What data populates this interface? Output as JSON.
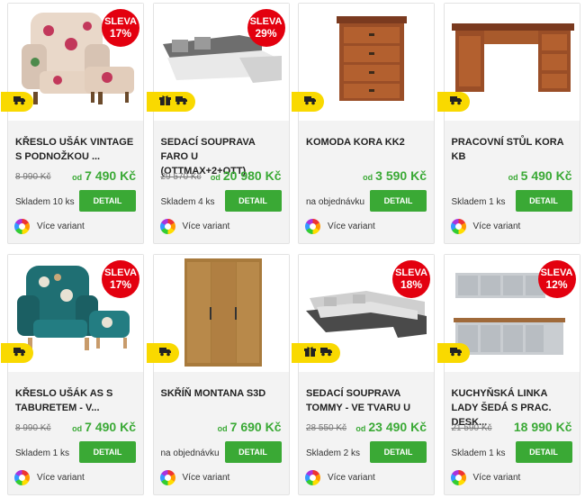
{
  "products": [
    {
      "title": "KŘESLO UŠÁK VINTAGE S PODNOŽKOU ...",
      "old_price": "8 990 Kč",
      "price_prefix": "od",
      "price": "7 490 Kč",
      "stock": "Skladem 10 ks",
      "button": "DETAIL",
      "variants": "Více variant",
      "sale_label": "SLEVA",
      "sale_pct": "17%",
      "tags": [
        "truck-icon"
      ]
    },
    {
      "title": "SEDACÍ SOUPRAVA FARO U (OTTMAX+2+OTT)",
      "old_price": "29 570 Kč",
      "price_prefix": "od",
      "price": "20 980 Kč",
      "stock": "Skladem 4 ks",
      "button": "DETAIL",
      "variants": "Více variant",
      "sale_label": "SLEVA",
      "sale_pct": "29%",
      "tags": [
        "gift-icon",
        "truck-icon"
      ]
    },
    {
      "title": "KOMODA KORA KK2",
      "old_price": "",
      "price_prefix": "od",
      "price": "3 590 Kč",
      "stock": "na objednávku",
      "button": "DETAIL",
      "variants": "Více variant",
      "sale_label": "",
      "sale_pct": "",
      "tags": [
        "truck-icon"
      ]
    },
    {
      "title": "PRACOVNÍ STŮL KORA KB",
      "old_price": "",
      "price_prefix": "od",
      "price": "5 490 Kč",
      "stock": "Skladem 1 ks",
      "button": "DETAIL",
      "variants": "Více variant",
      "sale_label": "",
      "sale_pct": "",
      "tags": [
        "truck-icon"
      ]
    },
    {
      "title": "KŘESLO UŠÁK AS S TABURETEM - V...",
      "old_price": "8 990 Kč",
      "price_prefix": "od",
      "price": "7 490 Kč",
      "stock": "Skladem 1 ks",
      "button": "DETAIL",
      "variants": "Více variant",
      "sale_label": "SLEVA",
      "sale_pct": "17%",
      "tags": [
        "truck-icon"
      ]
    },
    {
      "title": "SKŘÍŇ MONTANA S3D",
      "old_price": "",
      "price_prefix": "od",
      "price": "7 690 Kč",
      "stock": "na objednávku",
      "button": "DETAIL",
      "variants": "Více variant",
      "sale_label": "",
      "sale_pct": "",
      "tags": [
        "truck-icon"
      ]
    },
    {
      "title": "SEDACÍ SOUPRAVA TOMMY - VE TVARU U",
      "old_price": "28 550 Kč",
      "price_prefix": "od",
      "price": "23 490 Kč",
      "stock": "Skladem 2 ks",
      "button": "DETAIL",
      "variants": "Více variant",
      "sale_label": "SLEVA",
      "sale_pct": "18%",
      "tags": [
        "gift-icon",
        "truck-icon"
      ]
    },
    {
      "title": "KUCHYŇSKÁ LINKA LADY ŠEDÁ S PRAC. DESK...",
      "old_price": "21 590 Kč",
      "price_prefix": "",
      "price": "18 990 Kč",
      "stock": "Skladem 1 ks",
      "button": "DETAIL",
      "variants": "Více variant",
      "sale_label": "SLEVA",
      "sale_pct": "12%",
      "tags": [
        "truck-icon"
      ]
    }
  ],
  "colors": {
    "sale": "#e3000f",
    "accent_green": "#3aa935",
    "tag_yellow": "#f9d900"
  }
}
